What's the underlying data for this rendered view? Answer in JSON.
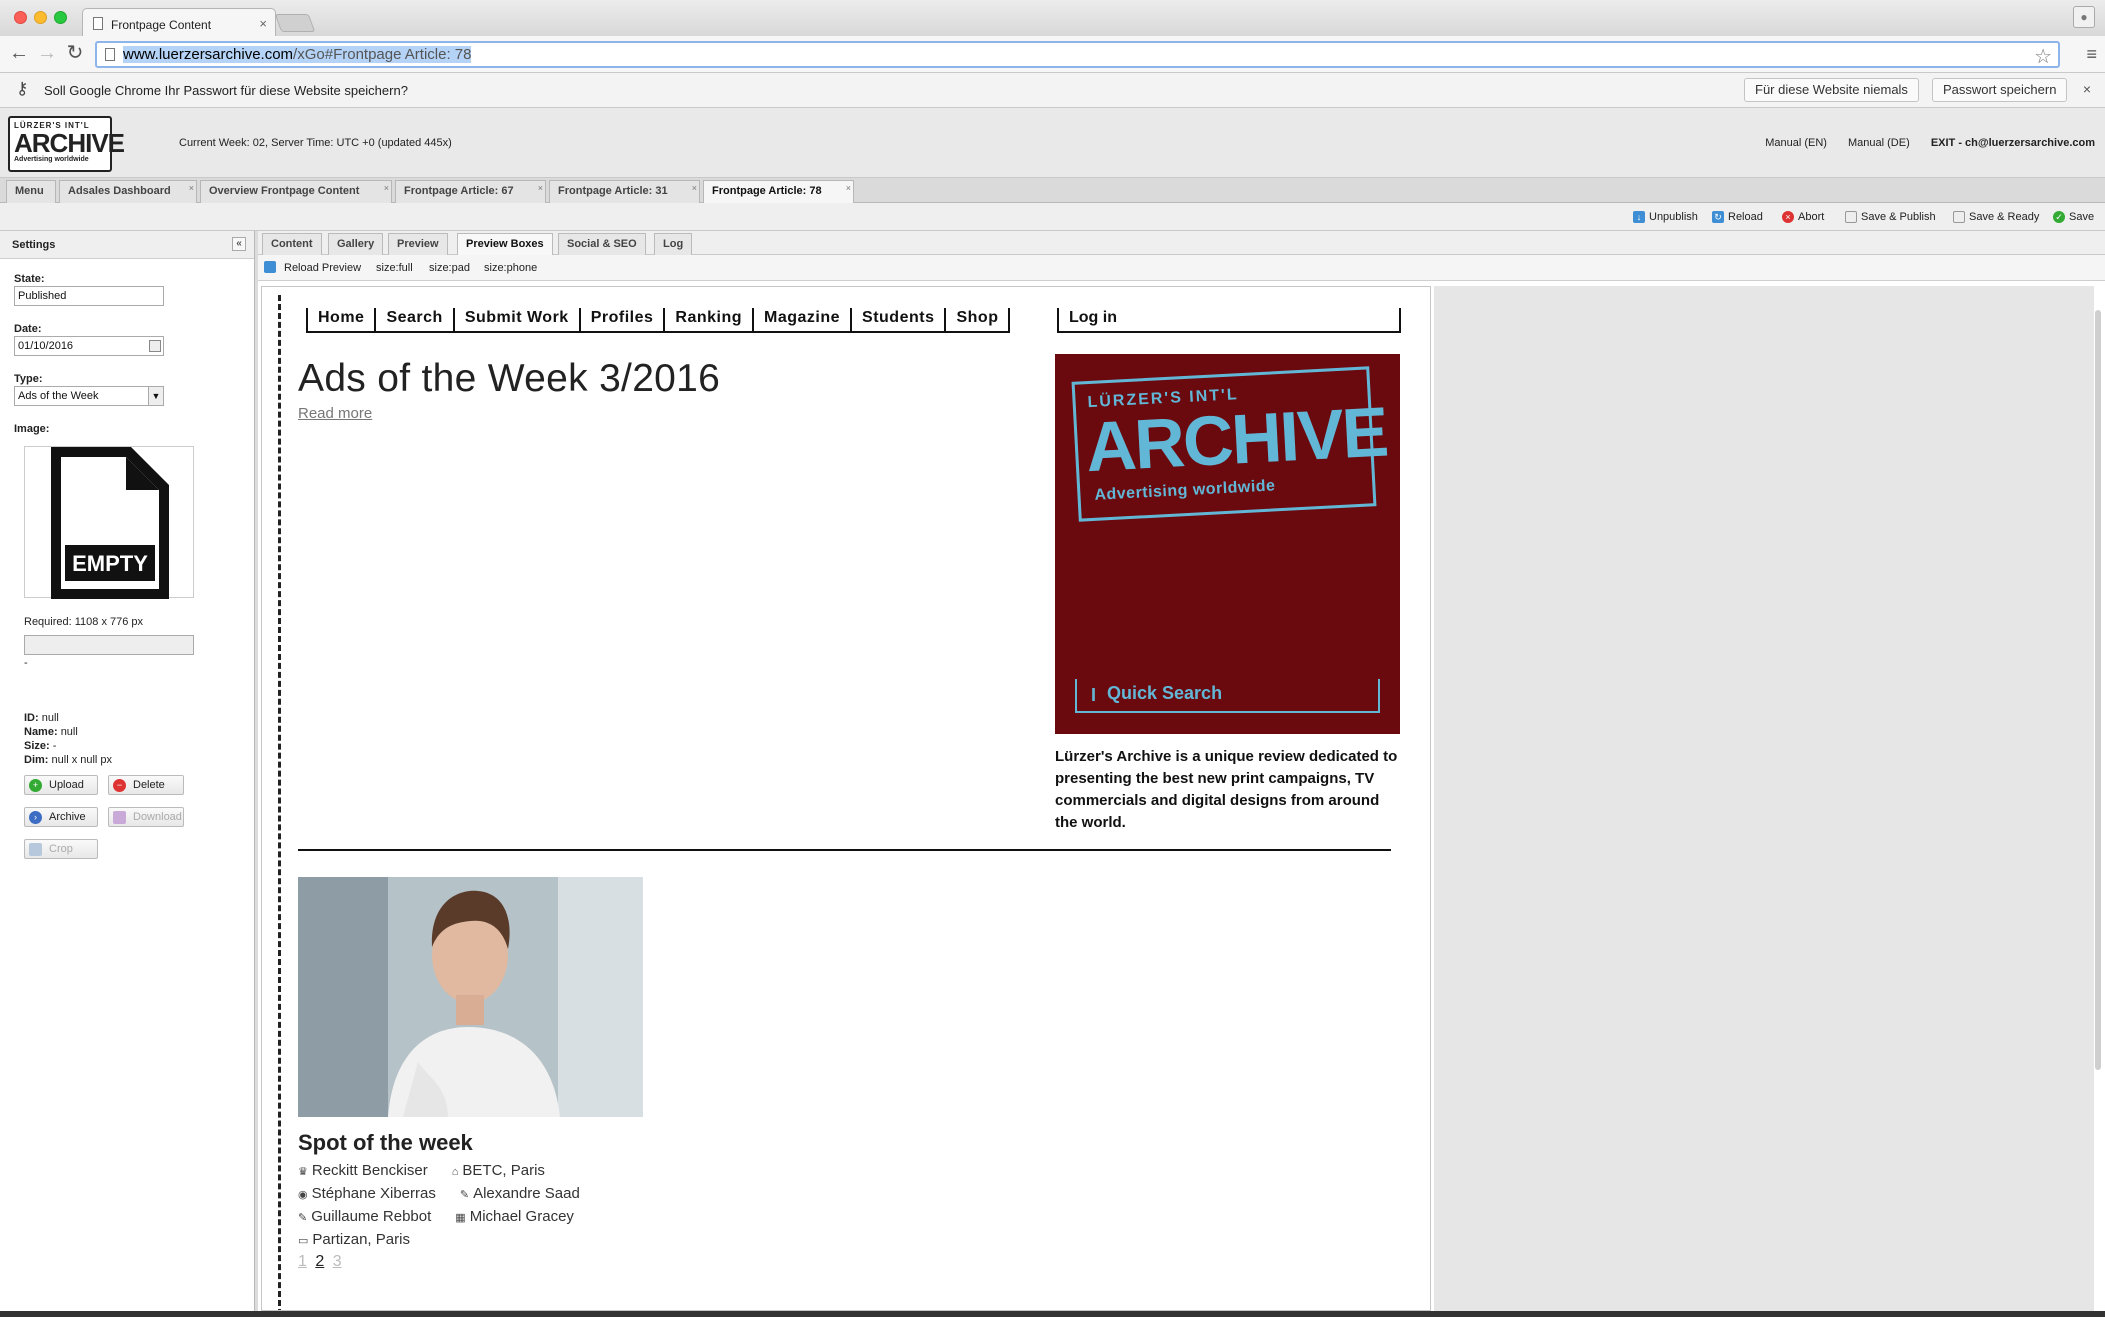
{
  "browser": {
    "tab_title": "Frontpage Content",
    "url_host": "www.luerzersarchive.com",
    "url_path": "/xGo#Frontpage Article: 78"
  },
  "password_bar": {
    "message": "Soll Google Chrome Ihr Passwort für diese Website speichern?",
    "never_label": "Für diese Website niemals",
    "save_label": "Passwort speichern",
    "close": "×"
  },
  "header": {
    "logo_line1": "LÜRZER'S INT'L",
    "logo_line2": "ARCHIVE",
    "logo_line3": "Advertising worldwide",
    "server_info": "Current Week: 02, Server Time: UTC +0 (updated 445x)",
    "manual_en": "Manual (EN)",
    "manual_de": "Manual (DE)",
    "exit": "EXIT - ch@luerzersarchive.com"
  },
  "app_tabs": [
    {
      "label": "Menu"
    },
    {
      "label": "Adsales Dashboard"
    },
    {
      "label": "Overview Frontpage Content"
    },
    {
      "label": "Frontpage Article: 67"
    },
    {
      "label": "Frontpage Article: 31"
    },
    {
      "label": "Frontpage Article: 78"
    }
  ],
  "actions": {
    "unpublish": "Unpublish",
    "reload": "Reload",
    "abort": "Abort",
    "save_publish": "Save & Publish",
    "save_ready": "Save & Ready",
    "save": "Save"
  },
  "settings": {
    "title": "Settings",
    "state_label": "State:",
    "state_value": "Published",
    "date_label": "Date:",
    "date_value": "01/10/2016",
    "type_label": "Type:",
    "type_value": "Ads of the Week",
    "image_label": "Image:",
    "empty_text": "EMPTY",
    "required": "Required: 1108 x 776 px",
    "dash": "-",
    "id_label": "ID:",
    "id_value": "null",
    "name_label": "Name:",
    "name_value": "null",
    "size_label": "Size:",
    "size_value": "-",
    "dim_label": "Dim:",
    "dim_value": "null x null px",
    "upload": "Upload",
    "delete": "Delete",
    "archive": "Archive",
    "download": "Download",
    "crop": "Crop"
  },
  "content_tabs": [
    {
      "label": "Content"
    },
    {
      "label": "Gallery"
    },
    {
      "label": "Preview"
    },
    {
      "label": "Preview Boxes"
    },
    {
      "label": "Social & SEO"
    },
    {
      "label": "Log"
    }
  ],
  "preview_bar": {
    "reload": "Reload Preview",
    "full": "size:full",
    "pad": "size:pad",
    "phone": "size:phone"
  },
  "site": {
    "nav": [
      "Home",
      "Search",
      "Submit Work",
      "Profiles",
      "Ranking",
      "Magazine",
      "Students",
      "Shop"
    ],
    "login": "Log in",
    "headline": "Ads of the Week 3/2016",
    "read_more": "Read more",
    "promo_line1": "LÜRZER'S INT'L",
    "promo_line2": "ARCHIVE",
    "promo_line3": "Advertising worldwide",
    "quick_search": "Quick Search",
    "description": "Lürzer's Archive is a unique review dedicated to presenting the best new print campaigns, TV commercials and digital designs from around the world.",
    "spot_title": "Spot of the week",
    "credits": {
      "client": "Reckitt Benckiser",
      "agency": "BETC, Paris",
      "person1": "Stéphane Xiberras",
      "person2": "Alexandre Saad",
      "person3": "Guillaume Rebbot",
      "person4": "Michael Gracey",
      "production": "Partizan, Paris"
    },
    "pages": [
      "1",
      "2",
      "3"
    ]
  },
  "colors": {
    "promo_bg": "#6a0a0f",
    "promo_accent": "#62b7d6"
  }
}
